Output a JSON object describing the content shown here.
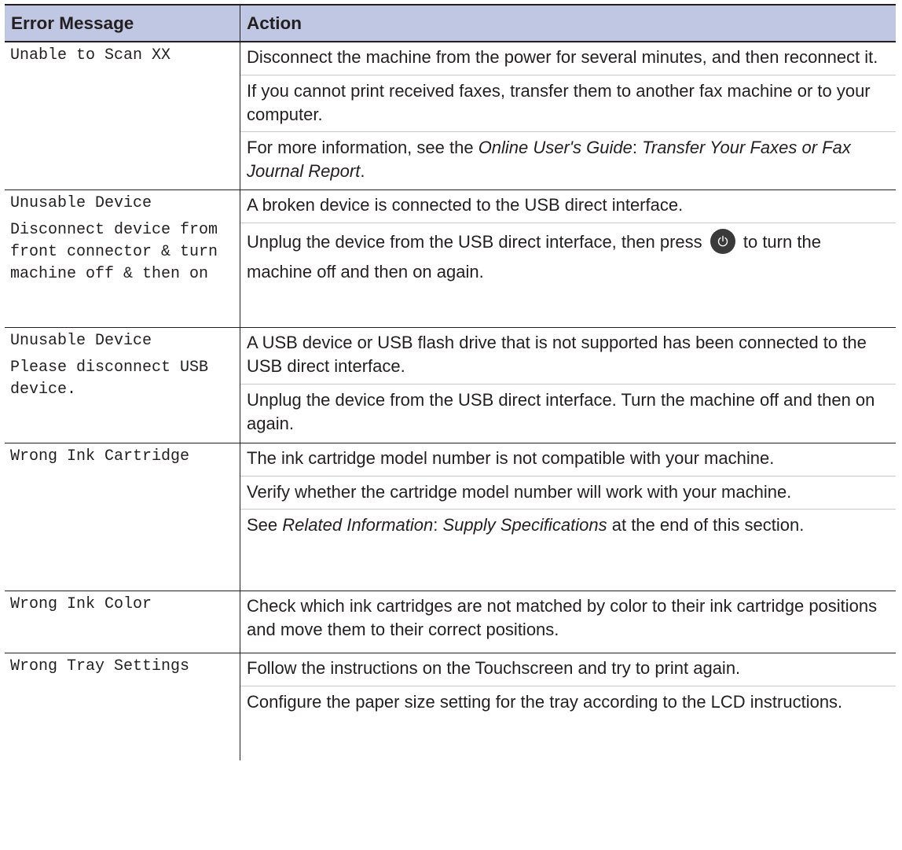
{
  "header": {
    "col_error": "Error Message",
    "col_action": "Action"
  },
  "rows": [
    {
      "error": [
        "Unable to Scan XX"
      ],
      "actions": [
        "Disconnect the machine from the power for several minutes, and then reconnect it.",
        "If you cannot print received faxes, transfer them to another fax machine or to your computer.",
        {
          "pre": "For more information, see the ",
          "em1": "Online User's Guide",
          "mid": ": ",
          "em2": "Transfer Your Faxes or Fax Journal Report",
          "post": "."
        }
      ]
    },
    {
      "error": [
        "Unusable Device",
        "Disconnect device from front connector & turn machine off & then on"
      ],
      "actions": [
        "A broken device is connected to the USB direct interface.",
        {
          "pre": "Unplug the device from the USB direct interface, then press",
          "icon": "power-icon",
          "post": "to turn the machine off and then on again."
        }
      ]
    },
    {
      "error": [
        "Unusable Device",
        "Please disconnect USB device."
      ],
      "actions": [
        "A USB device or USB flash drive that is not supported has been connected to the USB direct interface.",
        "Unplug the device from the USB direct interface. Turn the machine off and then on again."
      ]
    },
    {
      "error": [
        "Wrong Ink Cartridge"
      ],
      "actions": [
        "The ink cartridge model number is not compatible with your machine.",
        "Verify whether the cartridge model number will work with your machine.",
        {
          "pre": "See ",
          "em1": "Related Information",
          "mid": ": ",
          "em2": "Supply Specifications",
          "post": " at the end of this section."
        }
      ]
    },
    {
      "error": [
        "Wrong Ink Color"
      ],
      "actions": [
        "Check which ink cartridges are not matched by color to their ink cartridge positions and move them to their correct positions."
      ]
    },
    {
      "error": [
        "Wrong Tray Settings"
      ],
      "actions": [
        "Follow the instructions on the Touchscreen and try to print again.",
        "Configure the paper size setting for the tray according to the LCD instructions."
      ]
    }
  ],
  "colors": {
    "header_bg": "#c0c7e2",
    "text": "#231f20",
    "rule": "#231f20",
    "soft_rule": "#c9c9c9",
    "icon_bg": "#3a3a3a"
  }
}
